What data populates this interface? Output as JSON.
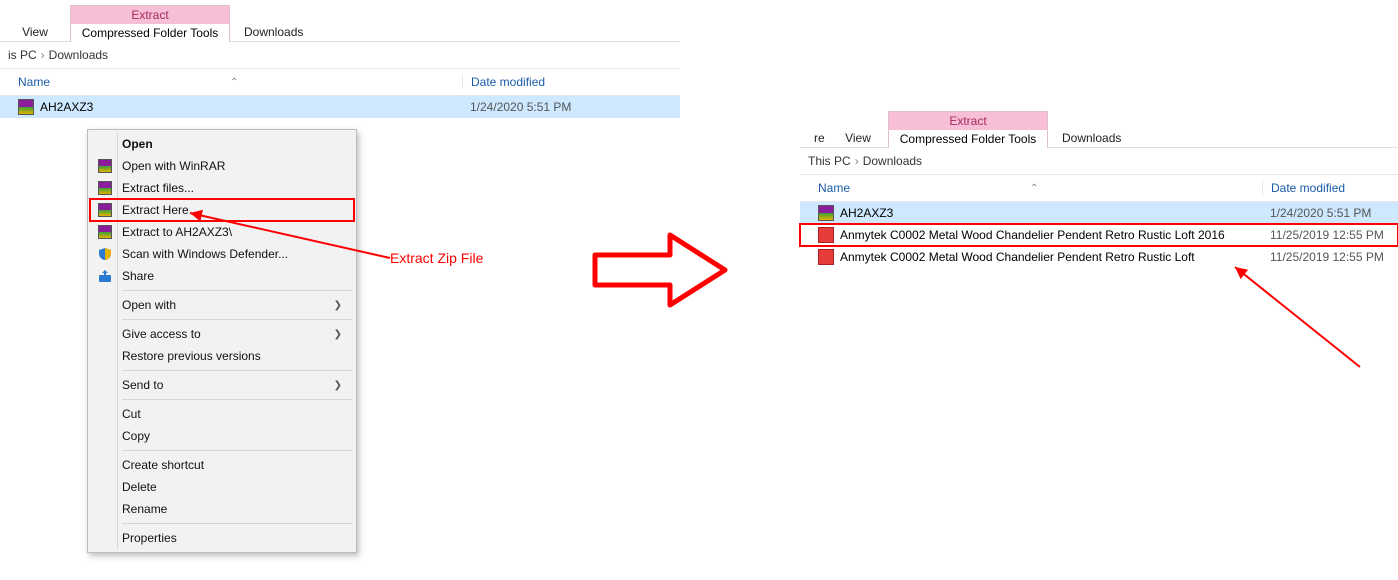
{
  "left_window": {
    "ribbon": {
      "view_tab": "View",
      "extract_tab_top": "Extract",
      "extract_tab_bottom": "Compressed Folder Tools",
      "downloads_tab": "Downloads"
    },
    "breadcrumb": {
      "part1": "is PC",
      "part2": "Downloads"
    },
    "headers": {
      "name": "Name",
      "date": "Date modified"
    },
    "files": [
      {
        "name": "AH2AXZ3",
        "date": "1/24/2020 5:51 PM",
        "icon": "rar",
        "selected": true
      }
    ],
    "context_menu": [
      {
        "label": "Open",
        "bold": true
      },
      {
        "label": "Open with WinRAR",
        "icon": "rar"
      },
      {
        "label": "Extract files...",
        "icon": "rar"
      },
      {
        "label": "Extract Here",
        "icon": "rar",
        "boxed": true
      },
      {
        "label": "Extract to AH2AXZ3\\",
        "icon": "rar"
      },
      {
        "label": "Scan with Windows Defender...",
        "icon": "shield"
      },
      {
        "label": "Share",
        "icon": "share"
      },
      {
        "sep": true
      },
      {
        "label": "Open with",
        "submenu": true
      },
      {
        "sep": true
      },
      {
        "label": "Give access to",
        "submenu": true
      },
      {
        "label": "Restore previous versions"
      },
      {
        "sep": true
      },
      {
        "label": "Send to",
        "submenu": true
      },
      {
        "sep": true
      },
      {
        "label": "Cut"
      },
      {
        "label": "Copy"
      },
      {
        "sep": true
      },
      {
        "label": "Create shortcut"
      },
      {
        "label": "Delete"
      },
      {
        "label": "Rename"
      },
      {
        "sep": true
      },
      {
        "label": "Properties"
      }
    ]
  },
  "right_window": {
    "ribbon": {
      "left_cut": "re",
      "view_tab": "View",
      "extract_tab_top": "Extract",
      "extract_tab_bottom": "Compressed Folder Tools",
      "downloads_tab": "Downloads"
    },
    "breadcrumb": {
      "part1": "This PC",
      "part2": "Downloads"
    },
    "headers": {
      "name": "Name",
      "date": "Date modified"
    },
    "files": [
      {
        "name": "AH2AXZ3",
        "date": "1/24/2020 5:51 PM",
        "icon": "rar",
        "selected": true
      },
      {
        "name": "Anmytek C0002 Metal Wood Chandelier Pendent Retro Rustic Loft  2016",
        "date": "11/25/2019 12:55 PM",
        "icon": "skp",
        "highlighted": true
      },
      {
        "name": "Anmytek C0002 Metal Wood Chandelier Pendent Retro Rustic Loft",
        "date": "11/25/2019 12:55 PM",
        "icon": "skp"
      }
    ]
  },
  "annotations": {
    "extract_label": "Extract Zip File"
  }
}
